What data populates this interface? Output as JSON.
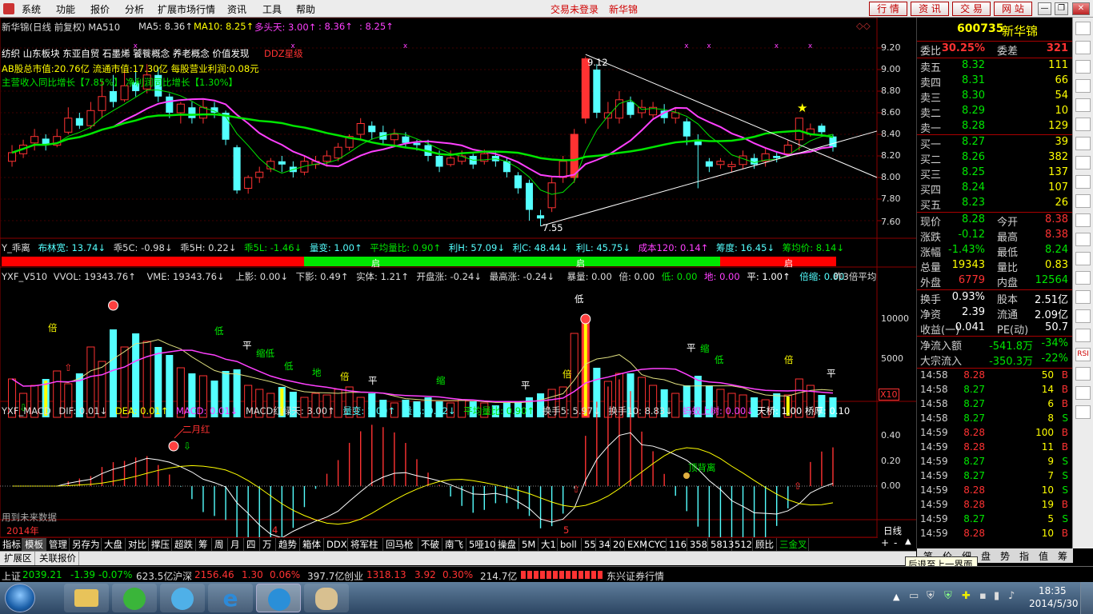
{
  "menu": {
    "items": [
      "系统",
      "功能",
      "报价",
      "分析",
      "扩展市场行情",
      "资讯",
      "工具",
      "帮助"
    ],
    "trade_status": "交易未登录",
    "stock_short": "新华锦",
    "top_buttons": [
      "行 情",
      "资 讯",
      "交 易",
      "网 站"
    ]
  },
  "chart_header": {
    "title": "新华锦(日线 前复权) MA510",
    "ma5": "MA5: 8.36↑",
    "ma10": "MA10: 8.25↑",
    "duotou": "多头天: 3.00↑",
    "v1": ": 8.36↑",
    "v2": ": 8.25↑"
  },
  "overlay": {
    "concepts": "纺织 山东板块 东亚自贸 石墨烯 饕餮概念 养老概念 价值发现",
    "ddz": "DDZ星级",
    "mktcap": "AB股总市值:20.76亿 流通市值:17.30亿 每股营业利润:0.08元",
    "growth_a": "主营收入同比增长【7.85%】",
    "growth_b": "净利润同比增长【1.30%】",
    "high_label": "9.12",
    "low_label": "7.55"
  },
  "price_axis": [
    "9.20",
    "9.00",
    "8.80",
    "8.60",
    "8.40",
    "8.20",
    "8.00",
    "7.80",
    "7.60"
  ],
  "panel2": {
    "name": "Y_乖离",
    "items": [
      "布林宽: 13.74↓",
      "乖5C: -0.98↓",
      "乖5H: 0.22↓",
      "乖5L: -1.46↓",
      "量变: 1.00↑",
      "平均量比: 0.90↑",
      "利H: 57.09↓",
      "利C: 48.44↓",
      "利L: 45.75↓",
      "成本120: 0.14↑",
      "筹度: 16.45↓",
      "筹均价: 8.14↓"
    ],
    "bar_marks": [
      "启",
      "启",
      "启"
    ]
  },
  "panel3": {
    "name": "YXF_V510",
    "items": [
      "VVOL: 19343.76↑",
      "VME: 19343.76↓",
      "上影: 0.00↓",
      "下影: 0.49↑",
      "实体: 1.21↑",
      "开盘涨: -0.24↓",
      "最高涨: -0.24↓",
      "暴量: 0.00",
      "倍: 0.00",
      "低: 0.00",
      "地: 0.00",
      "平: 1.00↑",
      "倍缩: 0.00"
    ],
    "right_note": "昨3倍平均",
    "axis": [
      "10000",
      "5000"
    ],
    "unit": "X10",
    "labels": [
      "倍",
      "低",
      "平",
      "缩低",
      "低",
      "地",
      "倍",
      "平",
      "缩",
      "平",
      "倍",
      "平",
      "缩",
      "低",
      "倍",
      "平",
      "低"
    ]
  },
  "panel4": {
    "name": "YXF_MACD",
    "items": [
      "DIF: 0.01↓",
      "DEA: 0.01↑",
      "MACD: 0.01↓",
      "MACD红绿天: 3.00↑",
      "量变: 1.00↑",
      "量比: 0.82↓",
      "平均量比: 0.90↑",
      "换手5: 5.97↓",
      "换手10: 8.83↓",
      "蚂蚁上树: 0.00↓",
      "天桥: 1.00",
      "桥厚: 0.10"
    ],
    "axis": [
      "0.40",
      "0.20",
      "0.00"
    ],
    "label_red": "二月红",
    "label_top": "顶背离",
    "footer": "用到未来数据"
  },
  "time_axis": [
    "2014年",
    "4",
    "5"
  ],
  "period": "日线",
  "quote": {
    "code": "600735",
    "name": "新华锦",
    "wb_label": "委比",
    "wb": "30.25%",
    "wc_label": "委差",
    "wc": "321",
    "asks": [
      {
        "label": "卖五",
        "price": "8.32",
        "vol": "111"
      },
      {
        "label": "卖四",
        "price": "8.31",
        "vol": "66"
      },
      {
        "label": "卖三",
        "price": "8.30",
        "vol": "54"
      },
      {
        "label": "卖二",
        "price": "8.29",
        "vol": "10"
      },
      {
        "label": "卖一",
        "price": "8.28",
        "vol": "129"
      }
    ],
    "bids": [
      {
        "label": "买一",
        "price": "8.27",
        "vol": "39"
      },
      {
        "label": "买二",
        "price": "8.26",
        "vol": "382"
      },
      {
        "label": "买三",
        "price": "8.25",
        "vol": "137"
      },
      {
        "label": "买四",
        "price": "8.24",
        "vol": "107"
      },
      {
        "label": "买五",
        "price": "8.23",
        "vol": "26"
      }
    ],
    "stats": [
      {
        "l1": "现价",
        "v1": "8.28",
        "l2": "今开",
        "v2": "8.38"
      },
      {
        "l1": "涨跌",
        "v1": "-0.12",
        "l2": "最高",
        "v2": "8.38"
      },
      {
        "l1": "涨幅",
        "v1": "-1.43%",
        "l2": "最低",
        "v2": "8.24"
      },
      {
        "l1": "总量",
        "v1": "19343",
        "l2": "量比",
        "v2": "0.83"
      },
      {
        "l1": "外盘",
        "v1": "6779",
        "l2": "内盘",
        "v2": "12564"
      }
    ],
    "fund": [
      {
        "l1": "换手",
        "v1": "0.93%",
        "l2": "股本",
        "v2": "2.51亿"
      },
      {
        "l1": "净资",
        "v1": "2.39",
        "l2": "流通",
        "v2": "2.09亿"
      },
      {
        "l1": "收益(一)",
        "v1": "0.041",
        "l2": "PE(动)",
        "v2": "50.7"
      }
    ],
    "flows": [
      {
        "label": "净流入额",
        "val": "-541.8万",
        "pct": "-34%"
      },
      {
        "label": "大宗流入",
        "val": "-350.3万",
        "pct": "-22%"
      }
    ],
    "ticks": [
      {
        "t": "14:58",
        "p": "8.28",
        "v": "50",
        "d": "B"
      },
      {
        "t": "14:58",
        "p": "8.27",
        "v": "14",
        "d": "B"
      },
      {
        "t": "14:58",
        "p": "8.27",
        "v": "6",
        "d": "B"
      },
      {
        "t": "14:58",
        "p": "8.27",
        "v": "8",
        "d": "S"
      },
      {
        "t": "14:59",
        "p": "8.28",
        "v": "100",
        "d": "B"
      },
      {
        "t": "14:59",
        "p": "8.28",
        "v": "11",
        "d": "B"
      },
      {
        "t": "14:59",
        "p": "8.27",
        "v": "9",
        "d": "S"
      },
      {
        "t": "14:59",
        "p": "8.27",
        "v": "7",
        "d": "S"
      },
      {
        "t": "14:59",
        "p": "8.28",
        "v": "10",
        "d": "S"
      },
      {
        "t": "14:59",
        "p": "8.28",
        "v": "19",
        "d": "B"
      },
      {
        "t": "14:59",
        "p": "8.27",
        "v": "5",
        "d": "S"
      },
      {
        "t": "14:59",
        "p": "8.28",
        "v": "10",
        "d": "B"
      }
    ],
    "bottom_tabs": [
      "笔",
      "价",
      "细",
      "盘",
      "势",
      "指",
      "值",
      "筹"
    ]
  },
  "right_toolbar": [
    "",
    "",
    "",
    "",
    "",
    "",
    "",
    "",
    "",
    "",
    "",
    "",
    "",
    "",
    "",
    "",
    "",
    "RSI",
    "",
    "",
    ""
  ],
  "tabs": [
    "指标",
    "模板",
    "管理",
    "另存为",
    "大盘",
    "对比",
    "撑压",
    "超跌",
    "筹",
    "周",
    "月",
    "四",
    "万",
    "趋势",
    "箱体",
    "DDX",
    "将军柱",
    "回马枪",
    "不破",
    "南飞",
    "5哑10",
    "操盘",
    "5M",
    "大1",
    "boll",
    "55",
    "34",
    "20",
    "EXM",
    "CYC",
    "116",
    "358",
    "5813",
    "512",
    "顾比",
    "三金叉"
  ],
  "tabs2": [
    "扩展区",
    "关联报价"
  ],
  "tooltip": "后退至上一界面",
  "status": {
    "sh_label": "上证",
    "sh": "2039.21",
    "sh_chg": "-1.39",
    "sh_pct": "-0.07%",
    "sh_amt": "623.5亿",
    "hs_label": "沪深",
    "hs": "2156.46",
    "hs_chg": "1.30",
    "hs_pct": "0.06%",
    "hs_amt": "397.7亿",
    "cy_label": "创业",
    "cy": "1318.13",
    "cy_chg": "3.92",
    "cy_pct": "0.30%",
    "cy_amt": "214.7亿",
    "broker": "东兴证券行情"
  },
  "clock": {
    "time": "18:35",
    "date": "2014/5/30"
  },
  "colors": {
    "up": "#ff3232",
    "down": "#54ffff",
    "green": "#00e600",
    "yellow": "#ffff00",
    "magenta": "#ff40ff",
    "menu_red": "#d00000"
  }
}
